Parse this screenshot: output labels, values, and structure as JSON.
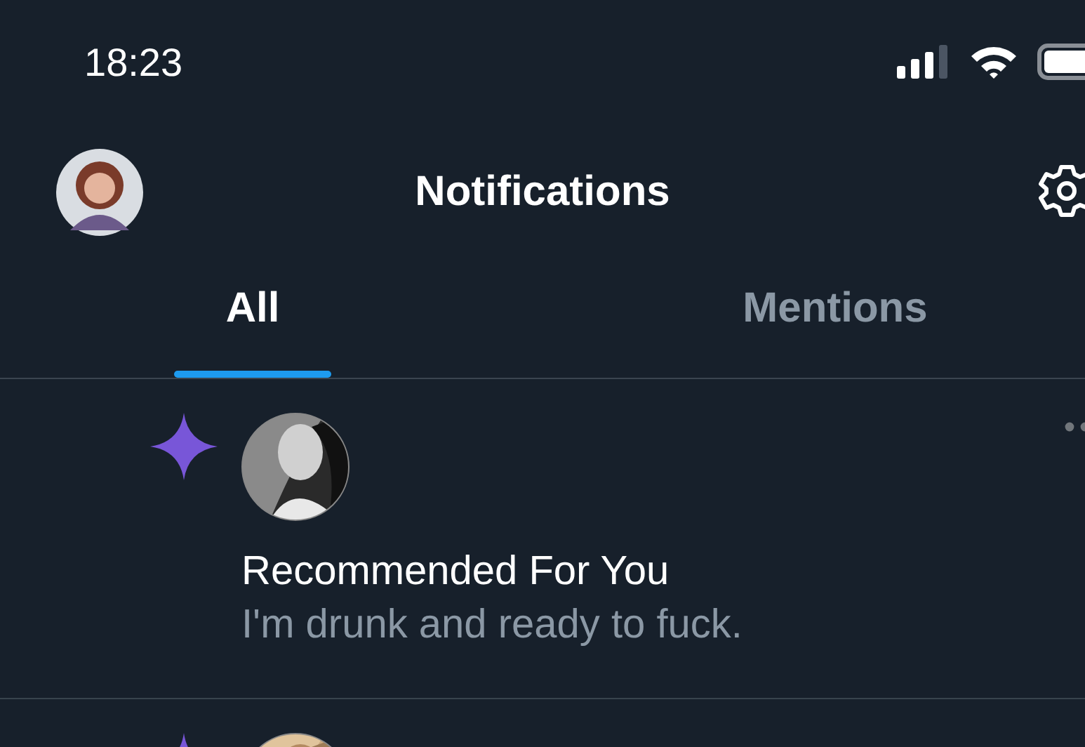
{
  "status_bar": {
    "time": "18:23"
  },
  "header": {
    "title": "Notifications"
  },
  "tabs": [
    {
      "label": "All",
      "selected": true
    },
    {
      "label": "Mentions",
      "selected": false
    }
  ],
  "notifications": [
    {
      "kind": "recommended",
      "title": "Recommended For You",
      "text": "I'm drunk and ready to fuck."
    },
    {
      "kind": "recommended"
    }
  ]
}
